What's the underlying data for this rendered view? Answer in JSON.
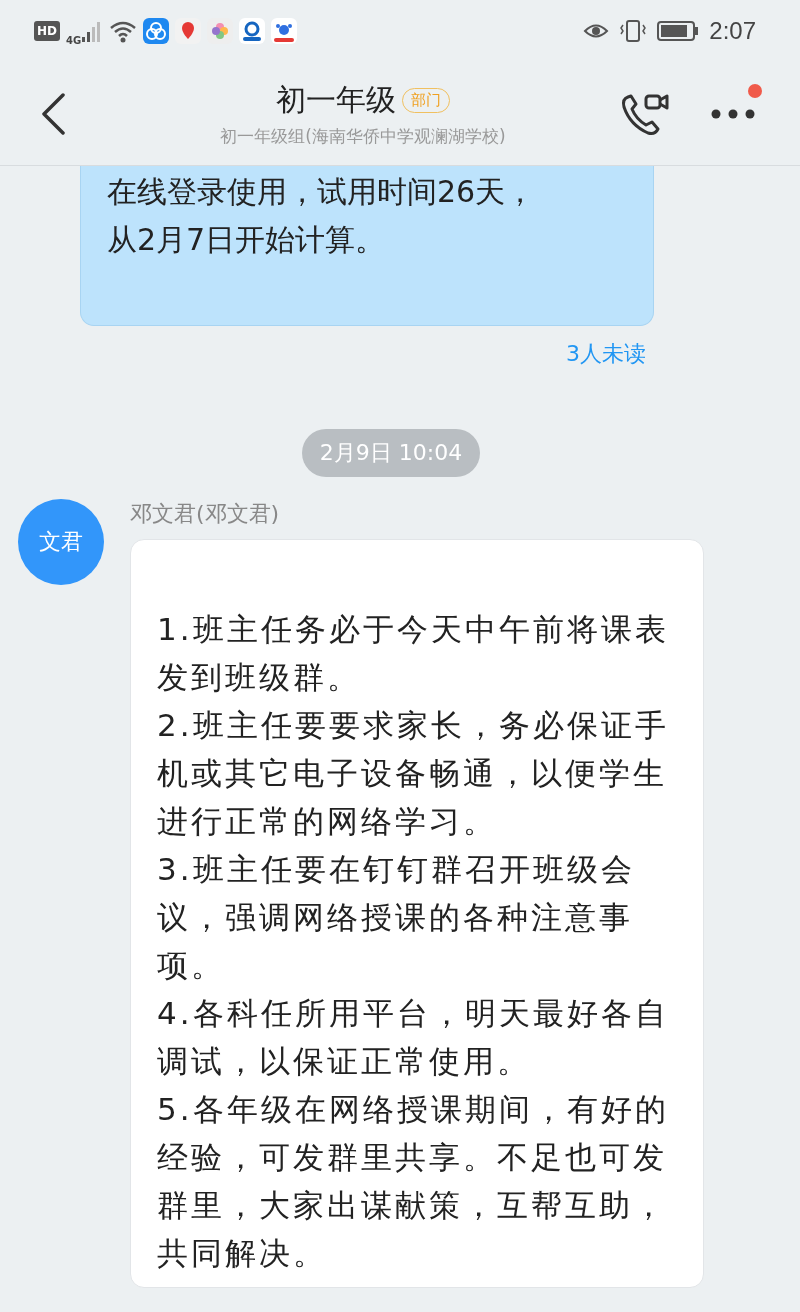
{
  "status_bar": {
    "hd": "HD",
    "network": "4G",
    "time": "2:07"
  },
  "header": {
    "title": "初一年级",
    "badge": "部门",
    "subtitle": "初一年级组(海南华侨中学观澜湖学校)",
    "more_has_dot": true
  },
  "messages": [
    {
      "kind": "outgoing",
      "lines": [
        "在线登录使用，试用时间26天，",
        "从2月7日开始计算。"
      ],
      "read_status": "3人未读"
    },
    {
      "kind": "time",
      "text": "2月9日 10:04"
    },
    {
      "kind": "incoming",
      "avatar": "文君",
      "sender": "邓文君(邓文君)",
      "paragraphs": [
        "1.班主任务必于今天中午前将课表发到班级群。",
        "2.班主任要要求家长，务必保证手机或其它电子设备畅通，以便学生进行正常的网络学习。",
        "3.班主任要在钉钉群召开班级会议，强调网络授课的各种注意事项。",
        "4.各科任所用平台，明天最好各自调试，以保证正常使用。",
        "5.各年级在网络授课期间，有好的经验，可发群里共享。不足也可发群里，大家出谋献策，互帮互助，共同解决。"
      ]
    }
  ]
}
